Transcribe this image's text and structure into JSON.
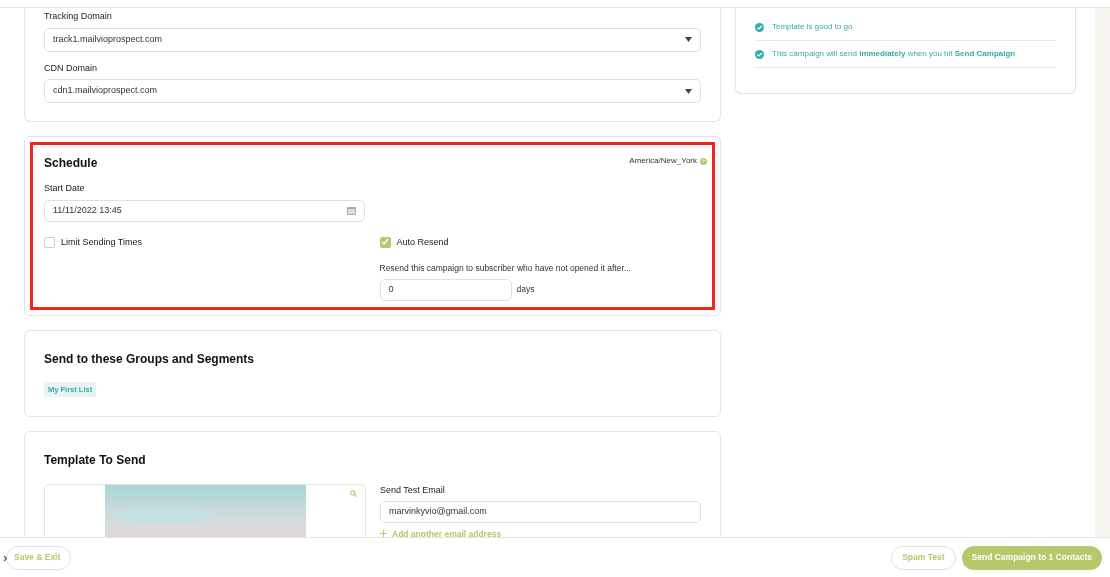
{
  "domains": [
    {
      "label": "Tracking Domain",
      "value": "track1.mailvioprospect.com"
    },
    {
      "label": "CDN Domain",
      "value": "cdn1.mailvioprospect.com"
    }
  ],
  "checklist": [
    {
      "text": "Template is good to go",
      "done": true
    },
    {
      "text": "This campaign will send **immediately** when you hit **Send Campaign**",
      "done": true
    }
  ],
  "schedule": {
    "title": "Schedule",
    "highlighted": true,
    "timezone": "America/New_York",
    "start_label": "Start Date",
    "start_value": "11/11/2022 13:45",
    "options": [
      {
        "label": "Limit Sending Times",
        "checked": false
      },
      {
        "label": "Auto Resend",
        "checked": true
      }
    ],
    "resend_text": "Resend this campaign to subscriber who have not opened it after...",
    "resend_value": "0",
    "resend_unit": "days"
  },
  "groups": {
    "title": "Send to these Groups and Segments",
    "tags": [
      "My First List"
    ]
  },
  "template": {
    "title": "Template To Send",
    "test_label": "Send Test Email",
    "test_value": "marvinkyvio@gmail.com",
    "add_link": "Add another email address"
  },
  "footer": {
    "left": "Save & Exit",
    "buttons": [
      {
        "label": "Spam Test",
        "primary": false
      },
      {
        "label": "Send Campaign to 1 Contacts",
        "primary": true
      }
    ]
  }
}
